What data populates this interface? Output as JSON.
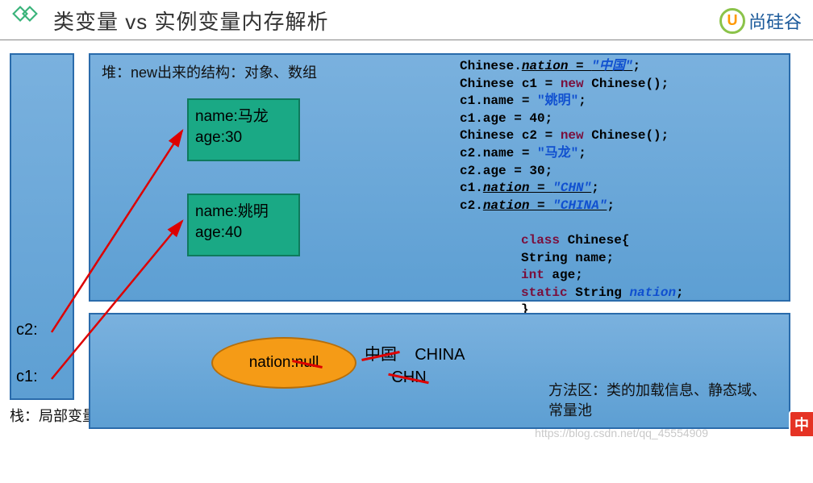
{
  "header": {
    "title": "类变量 vs 实例变量内存解析",
    "brand": "尚硅谷"
  },
  "stack": {
    "label": "栈：局部变量",
    "vars": {
      "c2": "c2:",
      "c1": "c1:"
    }
  },
  "heap": {
    "label": "堆：new出来的结构：对象、数组",
    "obj1": {
      "name": "name:马龙",
      "age": "age:30"
    },
    "obj2": {
      "name": "name:姚明",
      "age": "age:40"
    }
  },
  "method_area": {
    "nation_box": "nation:null",
    "vals": {
      "cn": "中国",
      "china": "CHINA",
      "chn": "CHN"
    },
    "label": "方法区：类的加载信息、静态域、常量池"
  },
  "code": {
    "l1a": "Chinese.",
    "l1b": "nation = ",
    "l1c": "\"中国\"",
    "l1d": ";",
    "l2a": "Chinese c1 = ",
    "l2b": "new ",
    "l2c": "Chinese();",
    "l3a": "c1.name = ",
    "l3b": "\"姚明\"",
    "l3c": ";",
    "l4": "c1.age = 40;",
    "l5a": "Chinese c2 = ",
    "l5b": "new ",
    "l5c": "Chinese();",
    "l6a": "c2.name = ",
    "l6b": "\"马龙\"",
    "l6c": ";",
    "l7": "c2.age = 30;",
    "l8a": "c1.",
    "l8b": "nation = ",
    "l8c": "\"CHN\"",
    "l8d": ";",
    "l9a": "c2.",
    "l9b": "nation = ",
    "l9c": "\"CHINA\"",
    "l9d": ";"
  },
  "classdef": {
    "l1a": "class ",
    "l1b": "Chinese{",
    "l2": "String name;",
    "l3a": "int ",
    "l3b": "age;",
    "l4a": "static ",
    "l4b": "String ",
    "l4c": "nation",
    "l4d": ";",
    "l5": "}"
  },
  "watermark": "https://blog.csdn.net/qq_45554909",
  "badge": "中"
}
